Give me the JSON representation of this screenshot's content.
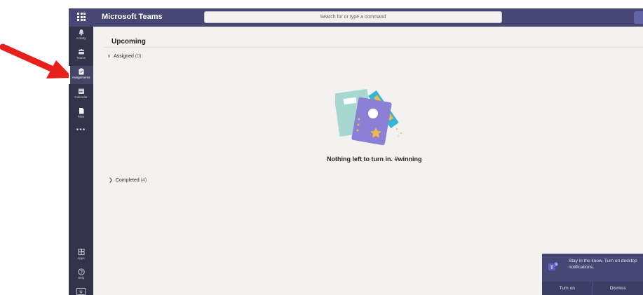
{
  "app": {
    "title": "Microsoft Teams"
  },
  "search": {
    "placeholder": "Search for or type a command"
  },
  "rail": {
    "items": [
      {
        "label": "Activity",
        "icon": "bell-icon"
      },
      {
        "label": "Teams",
        "icon": "teams-icon"
      },
      {
        "label": "Assignments",
        "icon": "assignments-icon",
        "active": true
      },
      {
        "label": "Calendar",
        "icon": "calendar-icon"
      },
      {
        "label": "Files",
        "icon": "files-icon"
      }
    ],
    "more": "•••",
    "bottom": [
      {
        "label": "Apps",
        "icon": "apps-icon"
      },
      {
        "label": "Help",
        "icon": "help-icon"
      }
    ]
  },
  "main": {
    "header": "Upcoming",
    "assigned": {
      "label": "Assigned",
      "count": "(0)"
    },
    "empty_message": "Nothing left to turn in. #winning",
    "completed": {
      "label": "Completed",
      "count": "(4)"
    }
  },
  "toast": {
    "message": "Stay in the know. Turn on desktop notifications.",
    "turn_on": "Turn on",
    "dismiss": "Dismiss"
  },
  "colors": {
    "accent": "#6264a7",
    "topbar": "#464775",
    "rail": "#33344a",
    "annotation_arrow": "#e8201c"
  }
}
